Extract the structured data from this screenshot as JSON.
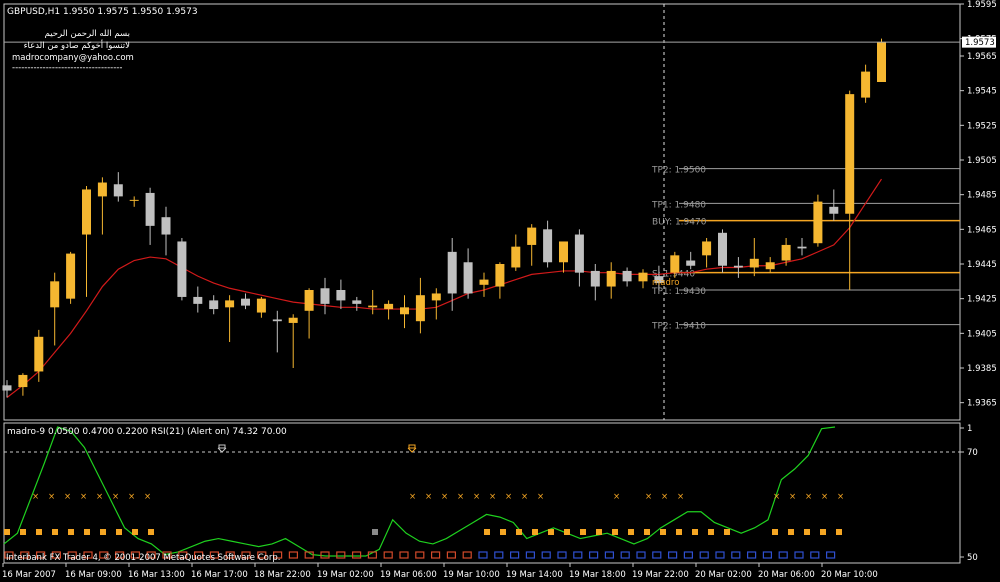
{
  "header": {
    "symbol_info": "GBPUSD,H1  1.9550 1.9575 1.9550 1.9573",
    "comment_lines": [
      "بسم الله الرحمن الرحيم",
      "لاتنسوا أخوكم صادو من الدعاء",
      "madrocompany@yahoo.com",
      "------------------------------------"
    ]
  },
  "indicator_header": "madro-9 0.0500 0.4700 0.2200  RSI(21) (Alert on) 74.32 70.00",
  "footer": "Interbank FX Trader 4, © 2001-2007 MetaQuotes Software Corp.",
  "current_price_label": "1.9573",
  "madro_label": "madro",
  "colors": {
    "background": "#000000",
    "bull": "#f5b731",
    "bear": "#c0c0c0",
    "ma": "#d21a1a",
    "rsi": "#1fd11f",
    "level_orange": "#f5a623",
    "level_grey": "#a0a0a0",
    "dot_orange": "#f5a623",
    "dot_grey": "#8a8a8a",
    "footer_red": "#d24a2a",
    "footer_blue": "#3050d0"
  },
  "chart_data": [
    {
      "type": "candlestick",
      "title": "GBPUSD,H1",
      "ylim": [
        1.9355,
        1.9595
      ],
      "y_ticks": [
        "1.9595",
        "1.9575",
        "1.9565",
        "1.9545",
        "1.9525",
        "1.9505",
        "1.9485",
        "1.9465",
        "1.9445",
        "1.9425",
        "1.9405",
        "1.9385",
        "1.9365"
      ],
      "x_labels": [
        "16 Mar 2007",
        "16 Mar 09:00",
        "16 Mar 13:00",
        "16 Mar 17:00",
        "18 Mar 22:00",
        "19 Mar 02:00",
        "19 Mar 06:00",
        "19 Mar 10:00",
        "19 Mar 14:00",
        "19 Mar 18:00",
        "19 Mar 22:00",
        "20 Mar 02:00",
        "20 Mar 06:00",
        "20 Mar 10:00"
      ],
      "candles": [
        {
          "o": 1.9375,
          "h": 1.9378,
          "l": 1.9368,
          "c": 1.9372
        },
        {
          "o": 1.9374,
          "h": 1.9382,
          "l": 1.9369,
          "c": 1.9381
        },
        {
          "o": 1.9383,
          "h": 1.9407,
          "l": 1.9377,
          "c": 1.9403
        },
        {
          "o": 1.942,
          "h": 1.944,
          "l": 1.9398,
          "c": 1.9435
        },
        {
          "o": 1.9425,
          "h": 1.9452,
          "l": 1.9422,
          "c": 1.9451
        },
        {
          "o": 1.9462,
          "h": 1.949,
          "l": 1.9426,
          "c": 1.9488
        },
        {
          "o": 1.9484,
          "h": 1.9495,
          "l": 1.9462,
          "c": 1.9492
        },
        {
          "o": 1.9491,
          "h": 1.9498,
          "l": 1.9481,
          "c": 1.9484
        },
        {
          "o": 1.9482,
          "h": 1.9484,
          "l": 1.9478,
          "c": 1.9482
        },
        {
          "o": 1.9486,
          "h": 1.9489,
          "l": 1.9456,
          "c": 1.9467
        },
        {
          "o": 1.9472,
          "h": 1.9478,
          "l": 1.945,
          "c": 1.9462
        },
        {
          "o": 1.9458,
          "h": 1.946,
          "l": 1.9424,
          "c": 1.9426
        },
        {
          "o": 1.9426,
          "h": 1.9432,
          "l": 1.9417,
          "c": 1.9422
        },
        {
          "o": 1.9424,
          "h": 1.9427,
          "l": 1.9416,
          "c": 1.9419
        },
        {
          "o": 1.942,
          "h": 1.9427,
          "l": 1.94,
          "c": 1.9424
        },
        {
          "o": 1.9425,
          "h": 1.9428,
          "l": 1.9419,
          "c": 1.9421
        },
        {
          "o": 1.9417,
          "h": 1.9426,
          "l": 1.9414,
          "c": 1.9425
        },
        {
          "o": 1.9413,
          "h": 1.9418,
          "l": 1.9394,
          "c": 1.9412
        },
        {
          "o": 1.9411,
          "h": 1.9416,
          "l": 1.9385,
          "c": 1.9414
        },
        {
          "o": 1.9418,
          "h": 1.9431,
          "l": 1.9402,
          "c": 1.943
        },
        {
          "o": 1.9431,
          "h": 1.9437,
          "l": 1.9416,
          "c": 1.9422
        },
        {
          "o": 1.943,
          "h": 1.9436,
          "l": 1.9419,
          "c": 1.9424
        },
        {
          "o": 1.9424,
          "h": 1.9426,
          "l": 1.9418,
          "c": 1.9422
        },
        {
          "o": 1.942,
          "h": 1.943,
          "l": 1.9416,
          "c": 1.9421
        },
        {
          "o": 1.9419,
          "h": 1.9424,
          "l": 1.9413,
          "c": 1.9422
        },
        {
          "o": 1.9416,
          "h": 1.9427,
          "l": 1.9408,
          "c": 1.942
        },
        {
          "o": 1.9412,
          "h": 1.9437,
          "l": 1.9405,
          "c": 1.9427
        },
        {
          "o": 1.9424,
          "h": 1.9431,
          "l": 1.9413,
          "c": 1.9428
        },
        {
          "o": 1.9452,
          "h": 1.946,
          "l": 1.9418,
          "c": 1.9428
        },
        {
          "o": 1.9446,
          "h": 1.9454,
          "l": 1.9425,
          "c": 1.9428
        },
        {
          "o": 1.9433,
          "h": 1.944,
          "l": 1.9426,
          "c": 1.9436
        },
        {
          "o": 1.9432,
          "h": 1.9446,
          "l": 1.9425,
          "c": 1.9445
        },
        {
          "o": 1.9443,
          "h": 1.9462,
          "l": 1.9441,
          "c": 1.9455
        },
        {
          "o": 1.9456,
          "h": 1.9468,
          "l": 1.9444,
          "c": 1.9466
        },
        {
          "o": 1.9465,
          "h": 1.947,
          "l": 1.9443,
          "c": 1.9446
        },
        {
          "o": 1.9446,
          "h": 1.9458,
          "l": 1.944,
          "c": 1.9458
        },
        {
          "o": 1.9462,
          "h": 1.9465,
          "l": 1.9432,
          "c": 1.944
        },
        {
          "o": 1.9441,
          "h": 1.9445,
          "l": 1.9424,
          "c": 1.9432
        },
        {
          "o": 1.9432,
          "h": 1.9446,
          "l": 1.9425,
          "c": 1.9441
        },
        {
          "o": 1.9441,
          "h": 1.9443,
          "l": 1.9432,
          "c": 1.9435
        },
        {
          "o": 1.9435,
          "h": 1.9442,
          "l": 1.9431,
          "c": 1.944
        },
        {
          "o": 1.9438,
          "h": 1.9444,
          "l": 1.943,
          "c": 1.9434
        },
        {
          "o": 1.944,
          "h": 1.9452,
          "l": 1.9437,
          "c": 1.945
        },
        {
          "o": 1.9447,
          "h": 1.9452,
          "l": 1.9442,
          "c": 1.9444
        },
        {
          "o": 1.945,
          "h": 1.946,
          "l": 1.9443,
          "c": 1.9458
        },
        {
          "o": 1.9463,
          "h": 1.9465,
          "l": 1.944,
          "c": 1.9444
        },
        {
          "o": 1.9444,
          "h": 1.9449,
          "l": 1.9437,
          "c": 1.9443
        },
        {
          "o": 1.9443,
          "h": 1.946,
          "l": 1.9438,
          "c": 1.9448
        },
        {
          "o": 1.9442,
          "h": 1.9449,
          "l": 1.944,
          "c": 1.9446
        },
        {
          "o": 1.9447,
          "h": 1.946,
          "l": 1.9444,
          "c": 1.9456
        },
        {
          "o": 1.9455,
          "h": 1.946,
          "l": 1.945,
          "c": 1.9454
        },
        {
          "o": 1.9457,
          "h": 1.9485,
          "l": 1.9455,
          "c": 1.9481
        },
        {
          "o": 1.9478,
          "h": 1.9488,
          "l": 1.947,
          "c": 1.9474
        },
        {
          "o": 1.9474,
          "h": 1.9545,
          "l": 1.943,
          "c": 1.9543
        },
        {
          "o": 1.9541,
          "h": 1.956,
          "l": 1.9538,
          "c": 1.9556
        },
        {
          "o": 1.955,
          "h": 1.9575,
          "l": 1.955,
          "c": 1.9573
        }
      ],
      "ma": [
        1.9368,
        1.9375,
        1.9383,
        1.9394,
        1.9405,
        1.9418,
        1.9432,
        1.9442,
        1.9447,
        1.9449,
        1.9448,
        1.9443,
        1.9438,
        1.9434,
        1.9431,
        1.9429,
        1.9427,
        1.9425,
        1.9423,
        1.9422,
        1.9421,
        1.942,
        1.942,
        1.9419,
        1.9419,
        1.9419,
        1.9419,
        1.942,
        1.9424,
        1.9428,
        1.943,
        1.9433,
        1.9436,
        1.9439,
        1.944,
        1.9441,
        1.9441,
        1.944,
        1.944,
        1.9439,
        1.9439,
        1.9439,
        1.944,
        1.944,
        1.9442,
        1.9443,
        1.9443,
        1.9444,
        1.9444,
        1.9446,
        1.9448,
        1.9452,
        1.9456,
        1.9466,
        1.948,
        1.9494
      ],
      "levels": [
        {
          "label": "TP2: 1.9500",
          "value": 1.95,
          "color": "grey"
        },
        {
          "label": "TP1: 1.9480",
          "value": 1.948,
          "color": "grey"
        },
        {
          "label": "BUY: 1.9470",
          "value": 1.947,
          "color": "orange"
        },
        {
          "label": "S: 1.9440",
          "value": 1.944,
          "color": "orange"
        },
        {
          "label": "TP1: 1.9430",
          "value": 1.943,
          "color": "grey"
        },
        {
          "label": "TP2: 1.9410",
          "value": 1.941,
          "color": "grey"
        }
      ],
      "current_price": 1.9573
    },
    {
      "type": "line",
      "title": "madro-9 0.0500 0.4700 0.2200  RSI(21) (Alert on) 74.32 70.00",
      "ylim": [
        50,
        100
      ],
      "y_ticks": [
        "1",
        "70",
        "50"
      ],
      "level": 70,
      "series": [
        {
          "name": "RSI(21)",
          "values": [
            56,
            60,
            73,
            86,
            100,
            98,
            92,
            82,
            72,
            62,
            58,
            56,
            52,
            53,
            55,
            57,
            58,
            57,
            56,
            55,
            56,
            58,
            55,
            52,
            50,
            50,
            50,
            48,
            54,
            65,
            60,
            57,
            56,
            58,
            61,
            64,
            67,
            66,
            64,
            58,
            60,
            62,
            60,
            58,
            59,
            60,
            58,
            56,
            58,
            62,
            65,
            68,
            68,
            64,
            62,
            60,
            62,
            65,
            80,
            84,
            89,
            99,
            104
          ]
        }
      ]
    }
  ]
}
